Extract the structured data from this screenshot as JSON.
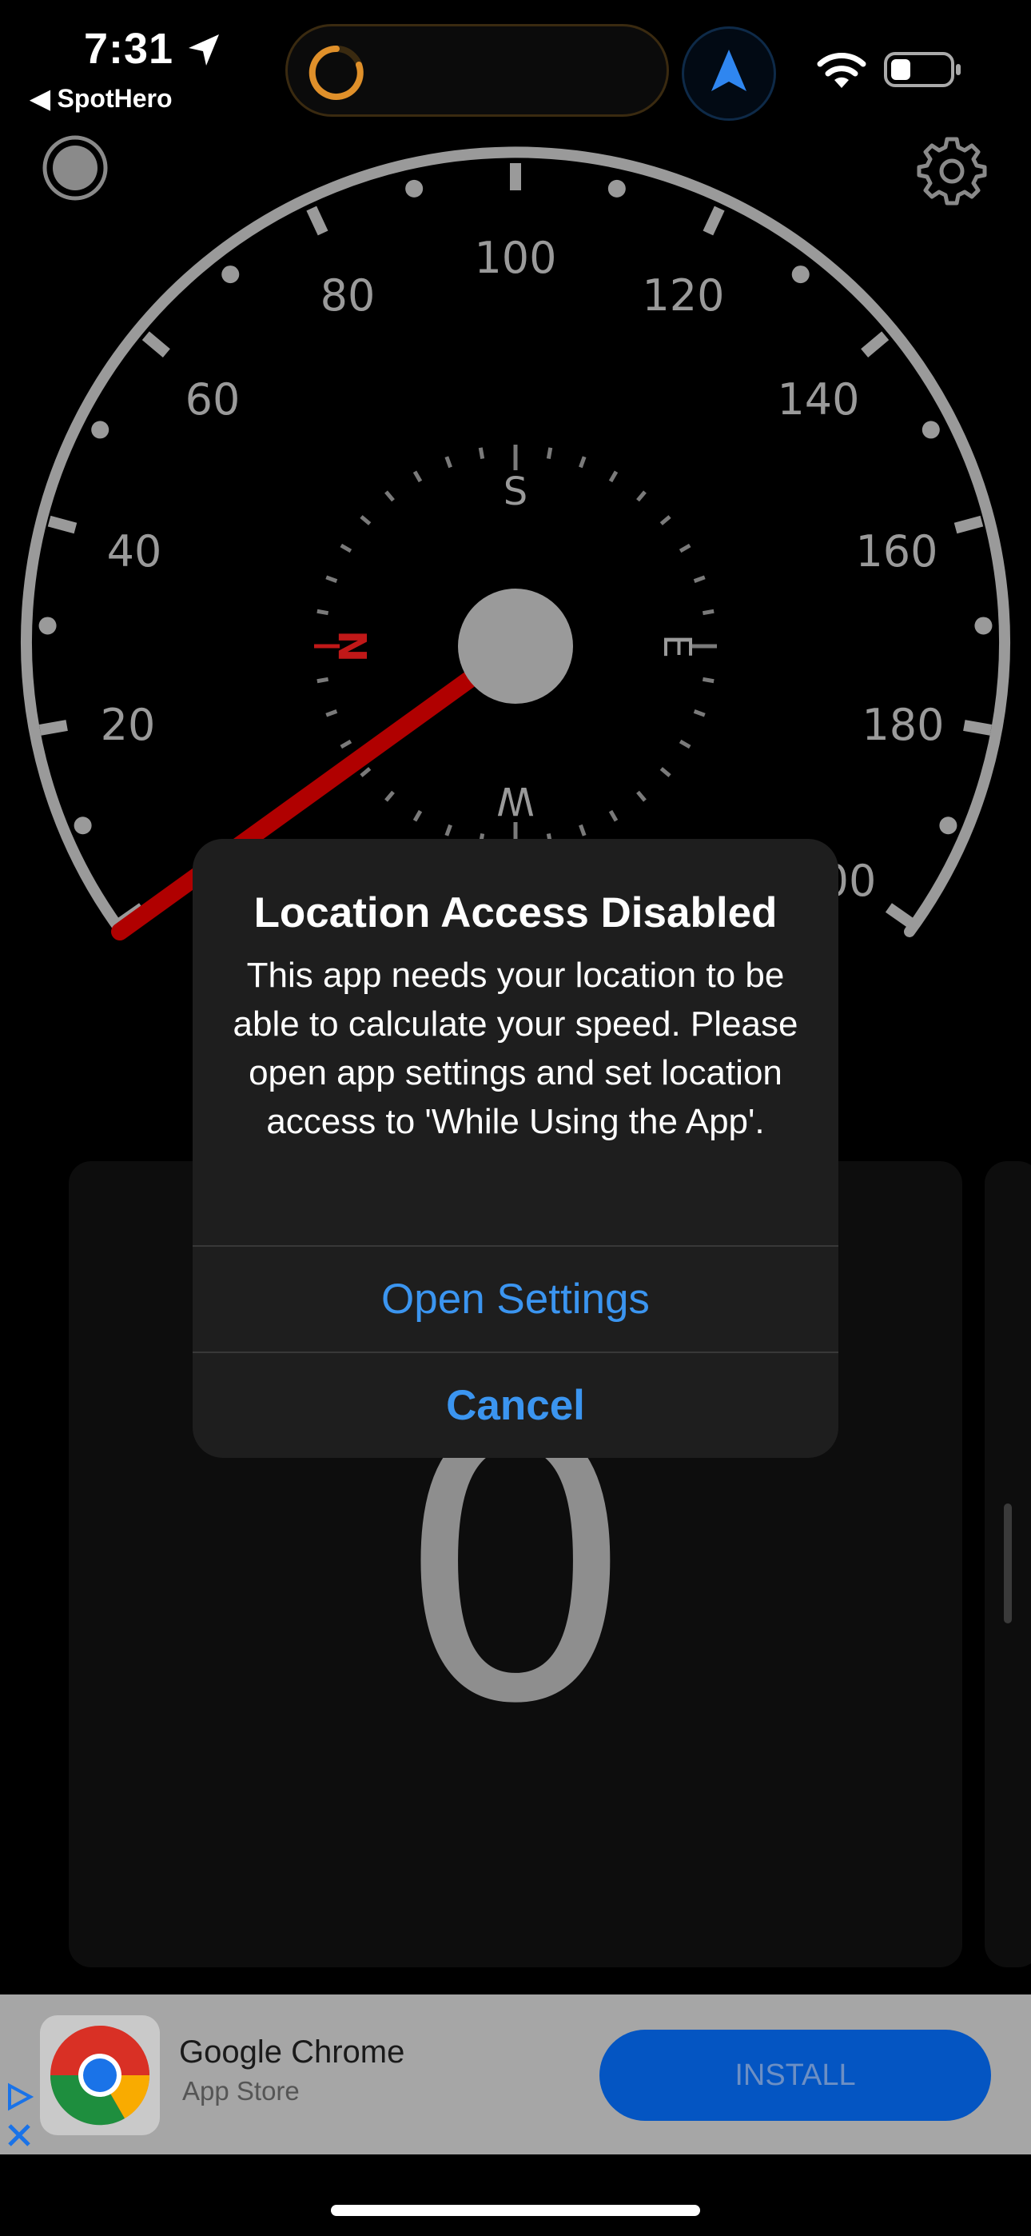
{
  "status_bar": {
    "time": "7:31",
    "back_app": "◀ SpotHero",
    "icons": [
      "location-arrow-icon",
      "wifi-icon",
      "battery-icon"
    ]
  },
  "gauge": {
    "ticks": [
      "20",
      "40",
      "60",
      "80",
      "100",
      "120",
      "140",
      "160",
      "180",
      "00"
    ],
    "compass": [
      "N",
      "E",
      "S",
      "W"
    ],
    "needle_color": "#b00000"
  },
  "speed": {
    "value": "0"
  },
  "alert": {
    "title": "Location Access Disabled",
    "message": "This app needs your location to be able to calculate your speed. Please open app settings and set location access to 'While Using the App'.",
    "open_settings": "Open Settings",
    "cancel": "Cancel",
    "button_color": "#3b95f0"
  },
  "ad": {
    "title": "Google Chrome",
    "subtitle": "App Store",
    "install": "INSTALL"
  },
  "colors": {
    "background": "#000000",
    "gauge": "#9a9a9a",
    "accent_blue": "#0455c2"
  }
}
